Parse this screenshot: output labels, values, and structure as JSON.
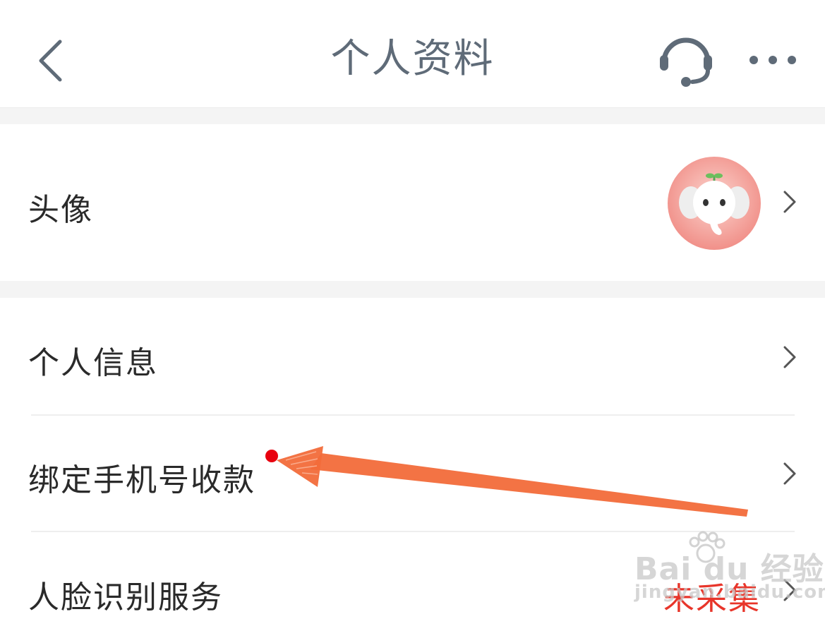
{
  "header": {
    "title": "个人资料",
    "back_icon": "chevron-left-icon",
    "service_icon": "headset-icon",
    "more_icon": "more-dots-icon"
  },
  "rows": [
    {
      "label": "头像",
      "value": "",
      "icon": "chevron-right-icon"
    },
    {
      "label": "个人信息",
      "value": "",
      "icon": "chevron-right-icon"
    },
    {
      "label": "绑定手机号收款",
      "value": "",
      "icon": "chevron-right-icon"
    },
    {
      "label": "人脸识别服务",
      "value": "未采集",
      "icon": "chevron-right-icon"
    }
  ],
  "watermark": {
    "brand": "Bai du 经验",
    "sub": "jingyan.baidu.com"
  },
  "colors": {
    "title": "#5f6b78",
    "text": "#2a2a2a",
    "status_red": "#e8352a",
    "arrow": "#f26c3a",
    "avatar_bg": "#f28b85",
    "separator": "#f4f4f4"
  }
}
